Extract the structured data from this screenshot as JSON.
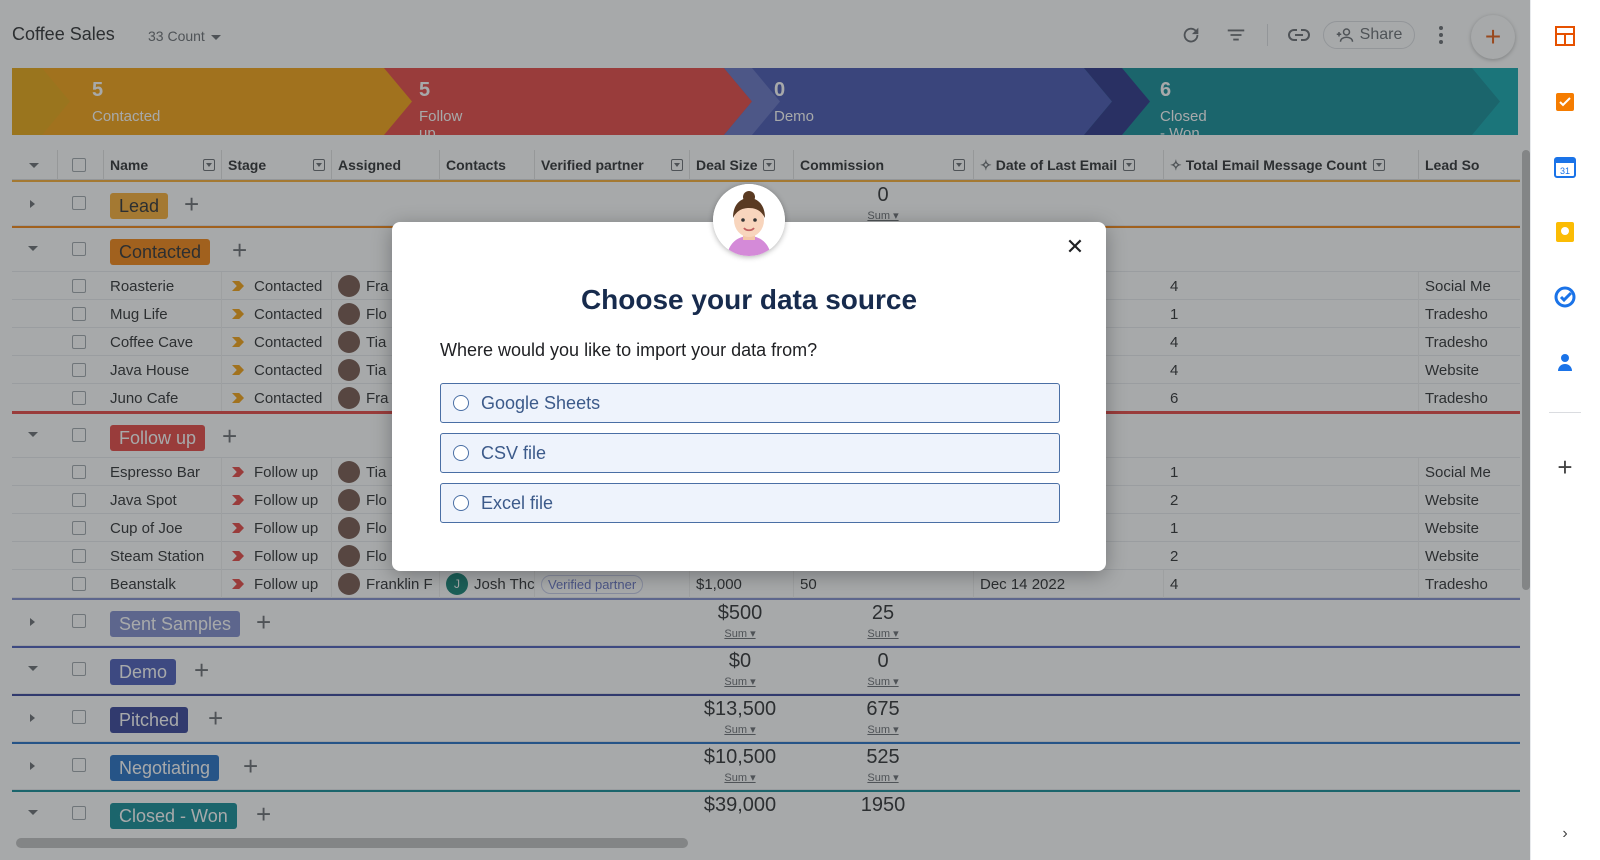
{
  "header": {
    "title": "Coffee Sales",
    "count_label": "33 Count",
    "share_label": "Share"
  },
  "pipeline": [
    {
      "count": "5",
      "label": "Contacted",
      "color": "#f59c00"
    },
    {
      "count": "5",
      "label": "Follow up",
      "color": "#e53935"
    },
    {
      "count": "0",
      "label": "Demo",
      "color": "#3949ab"
    },
    {
      "count": "6",
      "label": "Closed - Won",
      "color": "#00838f"
    }
  ],
  "columns": [
    "Name",
    "Stage",
    "Assigned",
    "Contacts",
    "Verified partner",
    "Deal Size",
    "Commission",
    "Date of Last Email",
    "Total Email Message Count",
    "Lead So"
  ],
  "groups": {
    "lead": {
      "label": "Lead",
      "color": "#f9a825",
      "commission_sum": "0",
      "sum_label": "Sum"
    },
    "contacted": {
      "label": "Contacted",
      "color": "#f57c00"
    },
    "followup": {
      "label": "Follow up",
      "color": "#e53935"
    },
    "sent": {
      "label": "Sent Samples",
      "color": "#7986cb",
      "deal_sum": "$500",
      "commission_sum": "25",
      "sum_label": "Sum"
    },
    "demo": {
      "label": "Demo",
      "color": "#3f51b5",
      "deal_sum": "$0",
      "commission_sum": "0",
      "sum_label": "Sum"
    },
    "pitched": {
      "label": "Pitched",
      "color": "#283593",
      "deal_sum": "$13,500",
      "commission_sum": "675",
      "sum_label": "Sum"
    },
    "negotiating": {
      "label": "Negotiating",
      "color": "#1565c0",
      "deal_sum": "$10,500",
      "commission_sum": "525",
      "sum_label": "Sum"
    },
    "closed": {
      "label": "Closed - Won",
      "color": "#00838f",
      "deal_sum": "$39,000",
      "commission_sum": "1950"
    }
  },
  "contacted_rows": [
    {
      "name": "Roasterie",
      "stage": "Contacted",
      "assigned": "Fra",
      "count": "4",
      "lead": "Social Me"
    },
    {
      "name": "Mug Life",
      "stage": "Contacted",
      "assigned": "Flo",
      "count": "1",
      "lead": "Tradesho"
    },
    {
      "name": "Coffee Cave",
      "stage": "Contacted",
      "assigned": "Tia",
      "count": "4",
      "lead": "Tradesho"
    },
    {
      "name": "Java House",
      "stage": "Contacted",
      "assigned": "Tia",
      "count": "4",
      "lead": "Website"
    },
    {
      "name": "Juno Cafe",
      "stage": "Contacted",
      "assigned": "Fra",
      "count": "6",
      "lead": "Tradesho"
    }
  ],
  "followup_rows": [
    {
      "name": "Espresso Bar",
      "stage": "Follow up",
      "assigned": "Tia",
      "count": "1",
      "lead": "Social Me"
    },
    {
      "name": "Java Spot",
      "stage": "Follow up",
      "assigned": "Flo",
      "count": "2",
      "lead": "Website"
    },
    {
      "name": "Cup of Joe",
      "stage": "Follow up",
      "assigned": "Flo",
      "count": "1",
      "lead": "Website"
    },
    {
      "name": "Steam Station",
      "stage": "Follow up",
      "assigned": "Flo",
      "count": "2",
      "lead": "Website"
    },
    {
      "name": "Beanstalk",
      "stage": "Follow up",
      "assigned": "Franklin F",
      "contact_initial": "J",
      "contact": "Josh Thc",
      "verified": "Verified partner",
      "deal": "$1,000",
      "commission": "50",
      "date": "Dec 14 2022",
      "count": "4",
      "lead": "Tradesho"
    }
  ],
  "dialog": {
    "title": "Choose your data source",
    "subtitle": "Where would you like to import your data from?",
    "options": [
      "Google Sheets",
      "CSV file",
      "Excel file"
    ]
  }
}
